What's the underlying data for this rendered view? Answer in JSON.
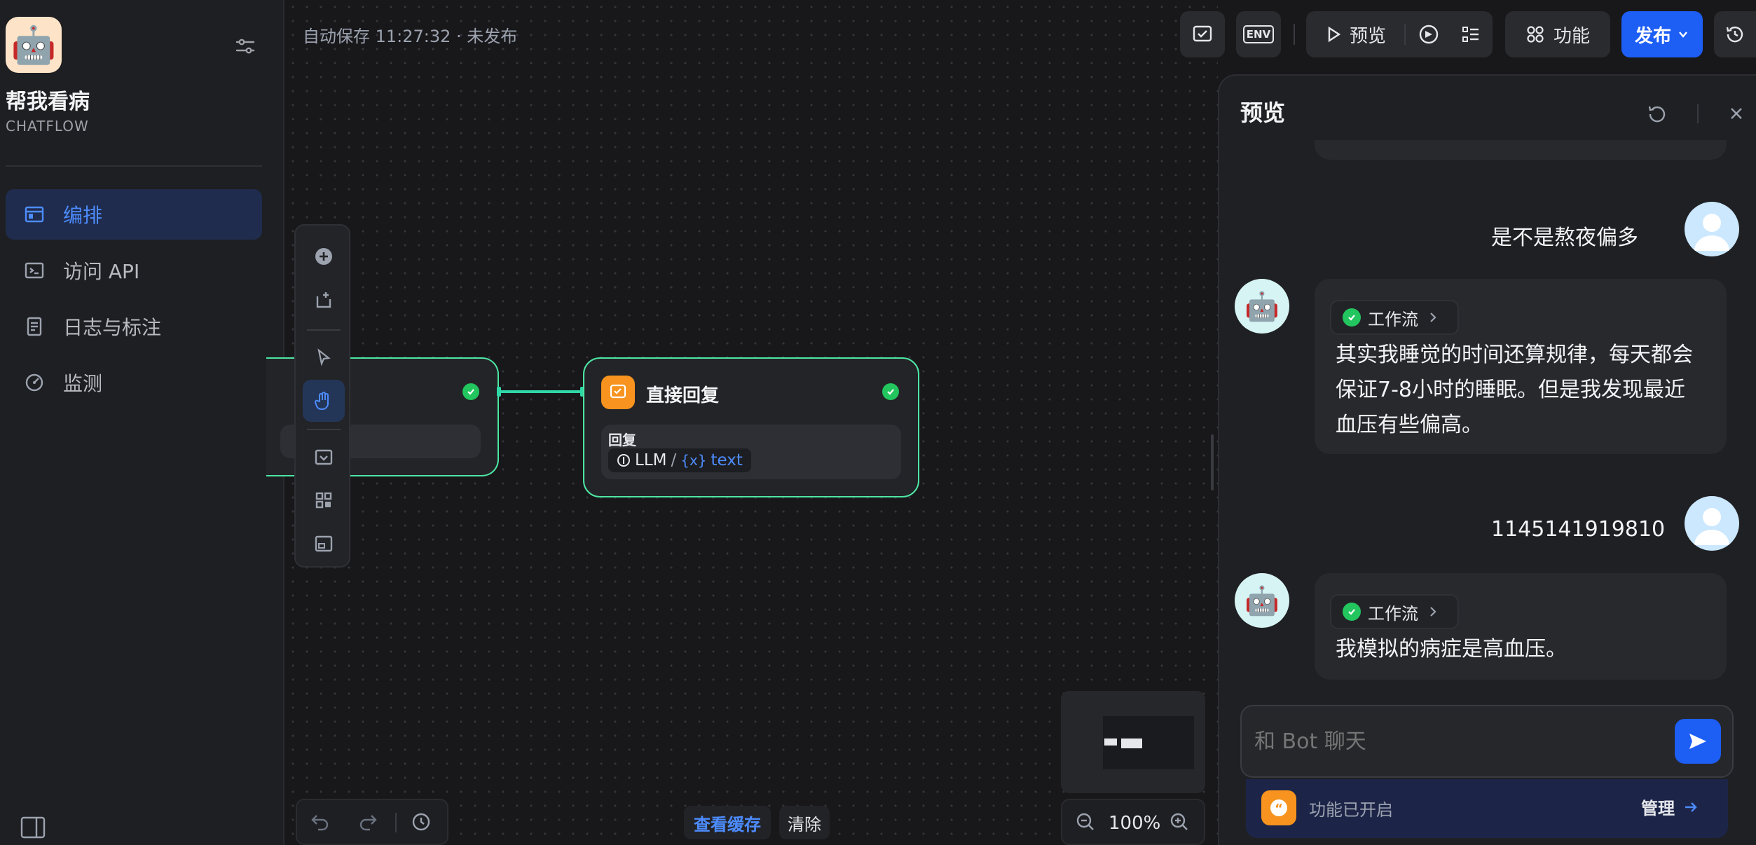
{
  "app": {
    "name": "帮我看病",
    "mode": "CHATFLOW",
    "icon_emoji": "🤖"
  },
  "sidebar": {
    "items": [
      {
        "label": "编排",
        "icon": "layout-icon",
        "active": true
      },
      {
        "label": "访问 API",
        "icon": "terminal-icon",
        "active": false
      },
      {
        "label": "日志与标注",
        "icon": "document-icon",
        "active": false
      },
      {
        "label": "监测",
        "icon": "gauge-icon",
        "active": false
      }
    ]
  },
  "header": {
    "autosave": "自动保存 11:27:32 · 未发布",
    "preview_label": "预览",
    "features_label": "功能",
    "publish_label": "发布",
    "env_label": "ENV"
  },
  "canvas": {
    "node_reply": {
      "title": "直接回复",
      "field_label": "回复",
      "var_source": "LLM",
      "var_sep": "/",
      "var_name_prefix": "{x}",
      "var_name": "text"
    },
    "bottom": {
      "view_cache": "查看缓存",
      "clear": "清除",
      "zoom": "100%"
    }
  },
  "preview": {
    "title": "预览",
    "messages": [
      {
        "role": "user",
        "text": "是不是熬夜偏多"
      },
      {
        "role": "bot",
        "workflow_label": "工作流",
        "lines": [
          "其实我睡觉的时间还算规律，每天都会",
          "保证7-8小时的睡眠。但是我发现最近",
          "血压有些偏高。"
        ]
      },
      {
        "role": "user",
        "text": "1145141919810"
      },
      {
        "role": "bot",
        "workflow_label": "工作流",
        "lines": [
          "我模拟的病症是高血压。"
        ]
      }
    ],
    "input_placeholder": "和 Bot 聊天",
    "feature_status": "功能已开启",
    "manage_label": "管理"
  },
  "colors": {
    "accent": "#1d5ef5",
    "node_border": "#4ee6a4",
    "success": "#22c55e",
    "reply_icon_bg": "#f7931e"
  }
}
